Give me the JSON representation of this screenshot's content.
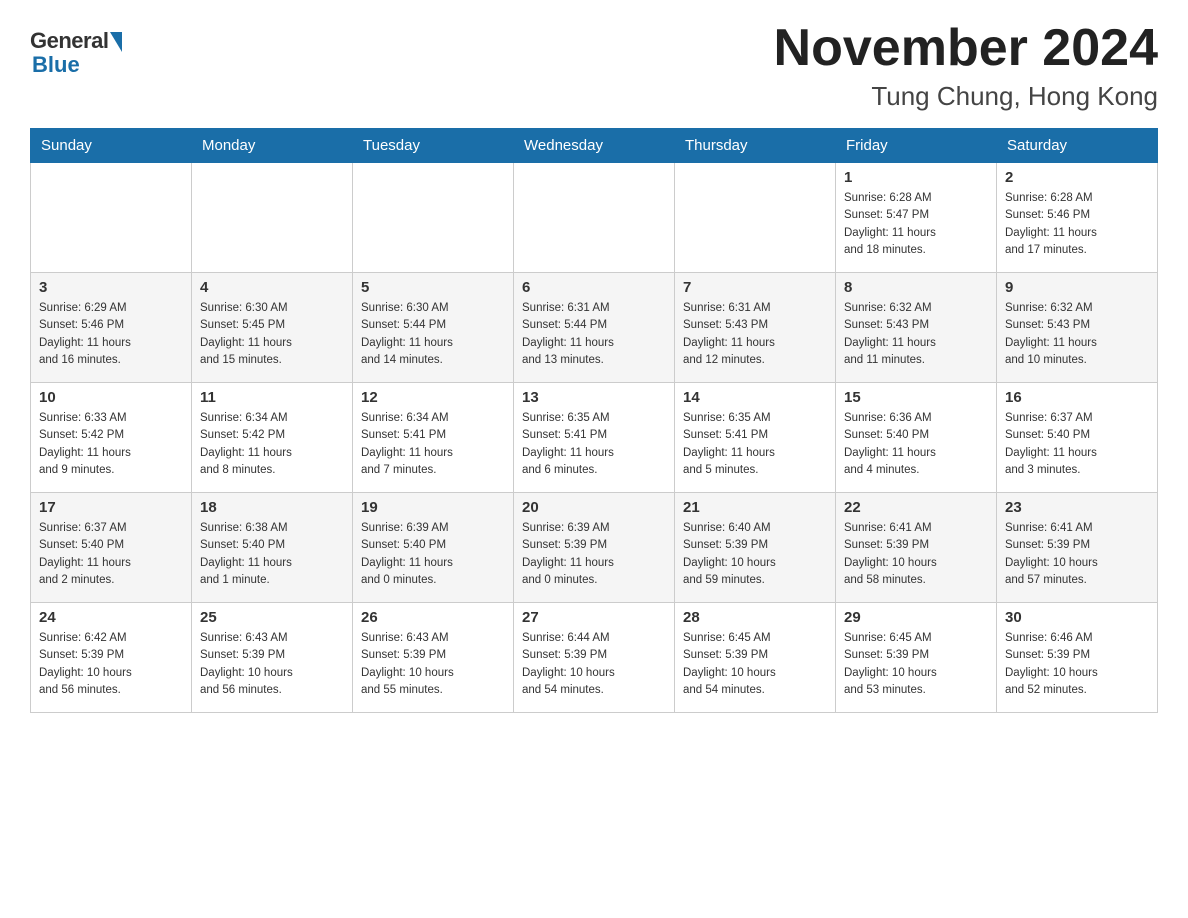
{
  "logo": {
    "general": "General",
    "blue": "Blue"
  },
  "header": {
    "month": "November 2024",
    "location": "Tung Chung, Hong Kong"
  },
  "days_of_week": [
    "Sunday",
    "Monday",
    "Tuesday",
    "Wednesday",
    "Thursday",
    "Friday",
    "Saturday"
  ],
  "weeks": [
    [
      {
        "day": "",
        "info": ""
      },
      {
        "day": "",
        "info": ""
      },
      {
        "day": "",
        "info": ""
      },
      {
        "day": "",
        "info": ""
      },
      {
        "day": "",
        "info": ""
      },
      {
        "day": "1",
        "info": "Sunrise: 6:28 AM\nSunset: 5:47 PM\nDaylight: 11 hours\nand 18 minutes."
      },
      {
        "day": "2",
        "info": "Sunrise: 6:28 AM\nSunset: 5:46 PM\nDaylight: 11 hours\nand 17 minutes."
      }
    ],
    [
      {
        "day": "3",
        "info": "Sunrise: 6:29 AM\nSunset: 5:46 PM\nDaylight: 11 hours\nand 16 minutes."
      },
      {
        "day": "4",
        "info": "Sunrise: 6:30 AM\nSunset: 5:45 PM\nDaylight: 11 hours\nand 15 minutes."
      },
      {
        "day": "5",
        "info": "Sunrise: 6:30 AM\nSunset: 5:44 PM\nDaylight: 11 hours\nand 14 minutes."
      },
      {
        "day": "6",
        "info": "Sunrise: 6:31 AM\nSunset: 5:44 PM\nDaylight: 11 hours\nand 13 minutes."
      },
      {
        "day": "7",
        "info": "Sunrise: 6:31 AM\nSunset: 5:43 PM\nDaylight: 11 hours\nand 12 minutes."
      },
      {
        "day": "8",
        "info": "Sunrise: 6:32 AM\nSunset: 5:43 PM\nDaylight: 11 hours\nand 11 minutes."
      },
      {
        "day": "9",
        "info": "Sunrise: 6:32 AM\nSunset: 5:43 PM\nDaylight: 11 hours\nand 10 minutes."
      }
    ],
    [
      {
        "day": "10",
        "info": "Sunrise: 6:33 AM\nSunset: 5:42 PM\nDaylight: 11 hours\nand 9 minutes."
      },
      {
        "day": "11",
        "info": "Sunrise: 6:34 AM\nSunset: 5:42 PM\nDaylight: 11 hours\nand 8 minutes."
      },
      {
        "day": "12",
        "info": "Sunrise: 6:34 AM\nSunset: 5:41 PM\nDaylight: 11 hours\nand 7 minutes."
      },
      {
        "day": "13",
        "info": "Sunrise: 6:35 AM\nSunset: 5:41 PM\nDaylight: 11 hours\nand 6 minutes."
      },
      {
        "day": "14",
        "info": "Sunrise: 6:35 AM\nSunset: 5:41 PM\nDaylight: 11 hours\nand 5 minutes."
      },
      {
        "day": "15",
        "info": "Sunrise: 6:36 AM\nSunset: 5:40 PM\nDaylight: 11 hours\nand 4 minutes."
      },
      {
        "day": "16",
        "info": "Sunrise: 6:37 AM\nSunset: 5:40 PM\nDaylight: 11 hours\nand 3 minutes."
      }
    ],
    [
      {
        "day": "17",
        "info": "Sunrise: 6:37 AM\nSunset: 5:40 PM\nDaylight: 11 hours\nand 2 minutes."
      },
      {
        "day": "18",
        "info": "Sunrise: 6:38 AM\nSunset: 5:40 PM\nDaylight: 11 hours\nand 1 minute."
      },
      {
        "day": "19",
        "info": "Sunrise: 6:39 AM\nSunset: 5:40 PM\nDaylight: 11 hours\nand 0 minutes."
      },
      {
        "day": "20",
        "info": "Sunrise: 6:39 AM\nSunset: 5:39 PM\nDaylight: 11 hours\nand 0 minutes."
      },
      {
        "day": "21",
        "info": "Sunrise: 6:40 AM\nSunset: 5:39 PM\nDaylight: 10 hours\nand 59 minutes."
      },
      {
        "day": "22",
        "info": "Sunrise: 6:41 AM\nSunset: 5:39 PM\nDaylight: 10 hours\nand 58 minutes."
      },
      {
        "day": "23",
        "info": "Sunrise: 6:41 AM\nSunset: 5:39 PM\nDaylight: 10 hours\nand 57 minutes."
      }
    ],
    [
      {
        "day": "24",
        "info": "Sunrise: 6:42 AM\nSunset: 5:39 PM\nDaylight: 10 hours\nand 56 minutes."
      },
      {
        "day": "25",
        "info": "Sunrise: 6:43 AM\nSunset: 5:39 PM\nDaylight: 10 hours\nand 56 minutes."
      },
      {
        "day": "26",
        "info": "Sunrise: 6:43 AM\nSunset: 5:39 PM\nDaylight: 10 hours\nand 55 minutes."
      },
      {
        "day": "27",
        "info": "Sunrise: 6:44 AM\nSunset: 5:39 PM\nDaylight: 10 hours\nand 54 minutes."
      },
      {
        "day": "28",
        "info": "Sunrise: 6:45 AM\nSunset: 5:39 PM\nDaylight: 10 hours\nand 54 minutes."
      },
      {
        "day": "29",
        "info": "Sunrise: 6:45 AM\nSunset: 5:39 PM\nDaylight: 10 hours\nand 53 minutes."
      },
      {
        "day": "30",
        "info": "Sunrise: 6:46 AM\nSunset: 5:39 PM\nDaylight: 10 hours\nand 52 minutes."
      }
    ]
  ]
}
